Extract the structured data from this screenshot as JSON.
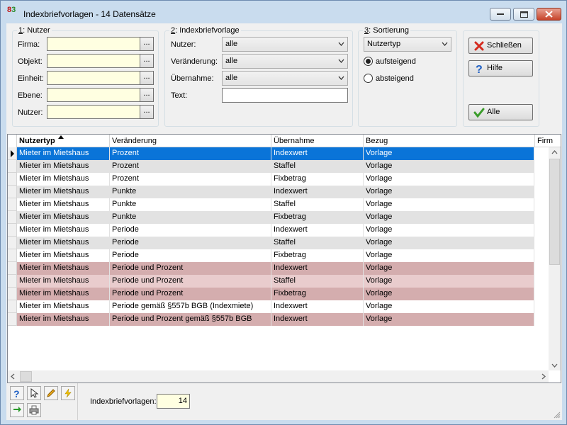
{
  "window": {
    "title": "Indexbriefvorlagen - 14 Datensätze"
  },
  "nutzer_group": {
    "title": "Nutzer",
    "title_key": "1",
    "fields": [
      {
        "label": "Firma:",
        "value": ""
      },
      {
        "label": "Objekt:",
        "value": ""
      },
      {
        "label": "Einheit:",
        "value": ""
      },
      {
        "label": "Ebene:",
        "value": ""
      },
      {
        "label": "Nutzer:",
        "value": ""
      }
    ],
    "browse_label": "..."
  },
  "vorlage_group": {
    "title": "Indexbriefvorlage",
    "title_key": "2",
    "nutzer_label": "Nutzer:",
    "nutzer_value": "alle",
    "veraenderung_label": "Veränderung:",
    "veraenderung_value": "alle",
    "uebernahme_label": "Übernahme:",
    "uebernahme_value": "alle",
    "text_label": "Text:",
    "text_value": ""
  },
  "sort_group": {
    "title": "Sortierung",
    "title_key": "3",
    "field": "Nutzertyp",
    "asc_label": "aufsteigend",
    "desc_label": "absteigend",
    "selected": "aufsteigend"
  },
  "buttons": {
    "close": "Schließen",
    "help": "Hilfe",
    "all": "Alle"
  },
  "grid": {
    "columns": [
      "Nutzertyp",
      "Veränderung",
      "Übernahme",
      "Bezug",
      "Firm"
    ],
    "sorted_column": "Nutzertyp",
    "rows": [
      {
        "nutzertyp": "Mieter im Mietshaus",
        "veraenderung": "Prozent",
        "uebernahme": "Indexwert",
        "bezug": "Vorlage",
        "state": "selected"
      },
      {
        "nutzertyp": "Mieter im Mietshaus",
        "veraenderung": "Prozent",
        "uebernahme": "Staffel",
        "bezug": "Vorlage",
        "state": "alt"
      },
      {
        "nutzertyp": "Mieter im Mietshaus",
        "veraenderung": "Prozent",
        "uebernahme": "Fixbetrag",
        "bezug": "Vorlage",
        "state": "normal"
      },
      {
        "nutzertyp": "Mieter im Mietshaus",
        "veraenderung": "Punkte",
        "uebernahme": "Indexwert",
        "bezug": "Vorlage",
        "state": "alt"
      },
      {
        "nutzertyp": "Mieter im Mietshaus",
        "veraenderung": "Punkte",
        "uebernahme": "Staffel",
        "bezug": "Vorlage",
        "state": "normal"
      },
      {
        "nutzertyp": "Mieter im Mietshaus",
        "veraenderung": "Punkte",
        "uebernahme": "Fixbetrag",
        "bezug": "Vorlage",
        "state": "alt"
      },
      {
        "nutzertyp": "Mieter im Mietshaus",
        "veraenderung": "Periode",
        "uebernahme": "Indexwert",
        "bezug": "Vorlage",
        "state": "normal"
      },
      {
        "nutzertyp": "Mieter im Mietshaus",
        "veraenderung": "Periode",
        "uebernahme": "Staffel",
        "bezug": "Vorlage",
        "state": "alt"
      },
      {
        "nutzertyp": "Mieter im Mietshaus",
        "veraenderung": "Periode",
        "uebernahme": "Fixbetrag",
        "bezug": "Vorlage",
        "state": "normal"
      },
      {
        "nutzertyp": "Mieter im Mietshaus",
        "veraenderung": "Periode und Prozent",
        "uebernahme": "Indexwert",
        "bezug": "Vorlage",
        "state": "red"
      },
      {
        "nutzertyp": "Mieter im Mietshaus",
        "veraenderung": "Periode und Prozent",
        "uebernahme": "Staffel",
        "bezug": "Vorlage",
        "state": "redl"
      },
      {
        "nutzertyp": "Mieter im Mietshaus",
        "veraenderung": "Periode und Prozent",
        "uebernahme": "Fixbetrag",
        "bezug": "Vorlage",
        "state": "red"
      },
      {
        "nutzertyp": "Mieter im Mietshaus",
        "veraenderung": "Periode gemäß §557b BGB (Indexmiete)",
        "uebernahme": "Indexwert",
        "bezug": "Vorlage",
        "state": "normal"
      },
      {
        "nutzertyp": "Mieter im Mietshaus",
        "veraenderung": "Periode und Prozent gemäß §557b BGB",
        "uebernahme": "Indexwert",
        "bezug": "Vorlage",
        "state": "red"
      }
    ]
  },
  "footer": {
    "count_label": "Indexbriefvorlagen:",
    "count_value": "14"
  },
  "colors": {
    "selected_row": "#0a74d8",
    "alt_row": "#e2e2e2",
    "red_row": "#d4adae",
    "red_row_light": "#e9cccd",
    "input_bg": "#ffffe1"
  },
  "icons": [
    "help-icon",
    "cursor-icon",
    "pencil-icon",
    "lightning-icon",
    "refresh-icon",
    "printer-icon",
    "close-x-icon",
    "check-icon"
  ]
}
